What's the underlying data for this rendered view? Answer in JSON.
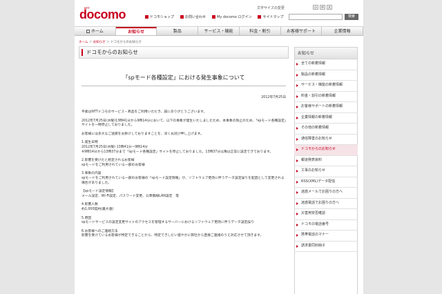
{
  "header": {
    "logo_ntt": "NTT",
    "logo": "docomo",
    "text_size_label": "文字サイズの変更",
    "text_size_options": [
      "小",
      "中",
      "大"
    ],
    "search_button": "検索",
    "utility_links": [
      "ドコモショップ",
      "お問い合わせ",
      "My docomo ログイン",
      "サイトマップ"
    ]
  },
  "nav": {
    "tabs": [
      "ホーム",
      "お知らせ",
      "製品",
      "サービス・機能",
      "料金・割引",
      "お客様サポート",
      "企業情報"
    ]
  },
  "breadcrumb": {
    "home": "ホーム",
    "notices": "お知らせ",
    "current": "ドコモからのお知らせ"
  },
  "main": {
    "section_title": "ドコモからのお知らせ",
    "article_title": "「spモード各種設定」における発生事象について",
    "date": "2012年7月25日",
    "paragraphs": [
      "平素はNTTドコモのサービス・商品をご利用いただき、誠にありがとうございます。",
      "2012年7月25日(水曜)13時41分から9時14分において、以下の事象が発生いたしましたため、本事象の防止のため、「spモード各種設定」サイトを一時停止しておりました。",
      "お客様には多大なご迷惑をお掛けしておりますことを、深くお詫び申し上げます。",
      "1.発生日時\n2012年7月25日(水曜) 13時41分～9時14分\n※9時14分から13時37分まで「spモード各種設定」サイトを停止しておりました。13時37分以降は正常に設定できております。",
      "2.影響を受けたと想定されるお客様\nspモードをご利用されている一部のお客様",
      "3.事象の内容\nspモードをご利用されている一部のお客様の「spモード設定情報」が、ソフトウェア更改に伴うデータ設定誤りを起因として変更される場合がありました。",
      "【spモード設定情報】\nメール設定、Wi-Fi設定、パスワード変更、公衆無線LAN設定　等",
      "4.影響人数\n約1,000契約(最大値)",
      "5.原因\nspモードサービスの設定変更サイトのアクセスを管理するサーバーにおけるソフトウェア更改に伴うデータ設定誤り",
      "6.お客様へのご連絡方法\n影響を受けているお客様が特定できることから、特定できしだい速やかに弊社から直接ご連絡のうえ対応させて頂きます。"
    ]
  },
  "sidebar": {
    "heading": "お知らせ",
    "items": [
      {
        "label": "全ての新着情報",
        "active": false
      },
      {
        "label": "製品の新着情報",
        "active": false
      },
      {
        "label": "サービス・機能の新着情報",
        "active": false
      },
      {
        "label": "料金・割引の新着情報",
        "active": false
      },
      {
        "label": "お客様サポートの新着情報",
        "active": false
      },
      {
        "label": "企業情報の新着情報",
        "active": false
      },
      {
        "label": "その他の新着情報",
        "active": false
      },
      {
        "label": "通信障害のお知らせ",
        "active": false
      },
      {
        "label": "ドコモからのお知らせ",
        "active": true
      },
      {
        "label": "報道発表資料",
        "active": false
      },
      {
        "label": "工事のお知らせ",
        "active": false
      },
      {
        "label": "RSS(XML)データ配信",
        "active": false
      },
      {
        "label": "迷惑メールでお困りの方へ",
        "active": false
      },
      {
        "label": "迷惑電話でお困りの方へ",
        "active": false
      },
      {
        "label": "災害用安否確認",
        "active": false
      },
      {
        "label": "ドコモの電話番号",
        "active": false
      },
      {
        "label": "携帯電話のマナー",
        "active": false
      },
      {
        "label": "請求書同封冊子",
        "active": false
      }
    ]
  },
  "colors": {
    "brand": "#c8001e",
    "active_bg": "#f6e3e7"
  }
}
